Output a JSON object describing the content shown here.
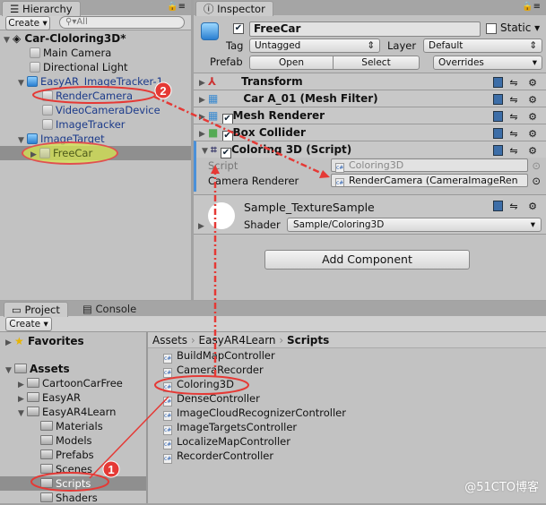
{
  "hierarchy": {
    "tab": "Hierarchy",
    "create": "Create",
    "search_placeholder": "All",
    "scene": "Car-Cloloring3D*",
    "items": [
      {
        "label": "Main Camera"
      },
      {
        "label": "Directional Light"
      },
      {
        "label": "EasyAR_ImageTracker-1"
      },
      {
        "label": "RenderCamera"
      },
      {
        "label": "VideoCameraDevice"
      },
      {
        "label": "ImageTracker"
      },
      {
        "label": "ImageTarget"
      },
      {
        "label": "FreeCar"
      }
    ]
  },
  "inspector": {
    "tab": "Inspector",
    "object_name": "FreeCar",
    "static_label": "Static",
    "tag_label": "Tag",
    "tag_value": "Untagged",
    "layer_label": "Layer",
    "layer_value": "Default",
    "prefab_label": "Prefab",
    "open": "Open",
    "select": "Select",
    "overrides": "Overrides",
    "components": [
      {
        "label": "Transform"
      },
      {
        "label": "Car A_01 (Mesh Filter)"
      },
      {
        "label": "Mesh Renderer"
      },
      {
        "label": "Box Collider"
      },
      {
        "label": "Coloring 3D (Script)"
      }
    ],
    "script_label": "Script",
    "script_value": "Coloring3D",
    "camera_renderer_label": "Camera Renderer",
    "camera_renderer_value": "RenderCamera (CameraImageRen",
    "material_name": "Sample_TextureSample",
    "shader_label": "Shader",
    "shader_value": "Sample/Coloring3D",
    "add_component": "Add Component"
  },
  "project": {
    "tab_project": "Project",
    "tab_console": "Console",
    "create": "Create",
    "favorites": "Favorites",
    "assets": "Assets",
    "tree": [
      {
        "label": "CartoonCarFree"
      },
      {
        "label": "EasyAR"
      },
      {
        "label": "EasyAR4Learn"
      },
      {
        "label": "Materials"
      },
      {
        "label": "Models"
      },
      {
        "label": "Prefabs"
      },
      {
        "label": "Scenes"
      },
      {
        "label": "Scripts"
      },
      {
        "label": "Shaders"
      }
    ],
    "breadcrumb": [
      "Assets",
      "EasyAR4Learn",
      "Scripts"
    ],
    "files": [
      {
        "label": "BuildMapController"
      },
      {
        "label": "CameraRecorder"
      },
      {
        "label": "Coloring3D"
      },
      {
        "label": "DenseController"
      },
      {
        "label": "ImageCloudRecognizerController"
      },
      {
        "label": "ImageTargetsController"
      },
      {
        "label": "LocalizeMapController"
      },
      {
        "label": "RecorderController"
      }
    ]
  },
  "annotations": {
    "badge1": "1",
    "badge2": "2",
    "accent": "#e53935"
  },
  "watermark": "@51CTO博客"
}
